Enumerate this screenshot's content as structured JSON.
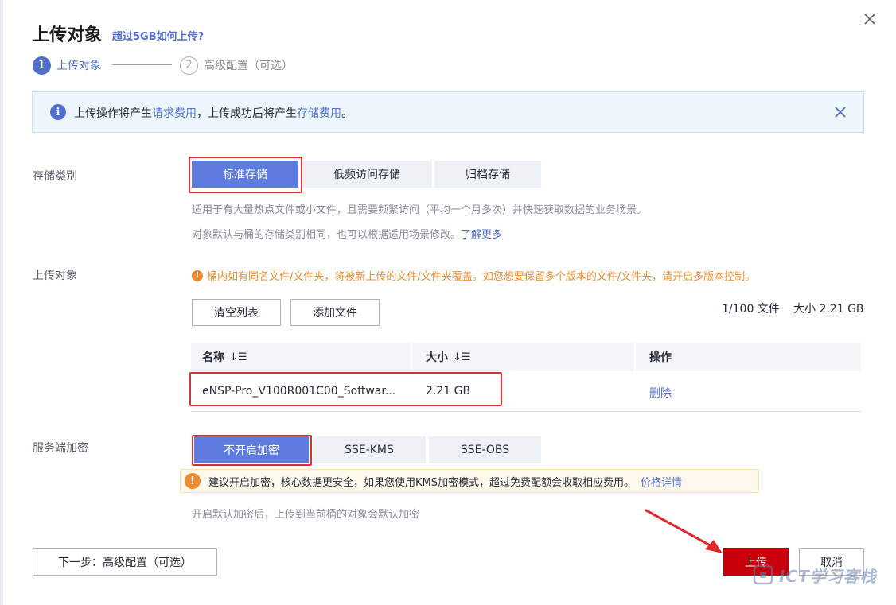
{
  "dialog": {
    "title": "上传对象",
    "title_link": "超过5GB如何上传?",
    "close_icon": "close-icon"
  },
  "steps": [
    {
      "number": "1",
      "label": "上传对象"
    },
    {
      "number": "2",
      "label": "高级配置（可选）"
    }
  ],
  "alert": {
    "text_1": "上传操作将产生",
    "link_1": "请求费用",
    "text_2": "，上传成功后将产生",
    "link_2": "存储费用",
    "text_3": "。"
  },
  "storage": {
    "label": "存储类别",
    "options": [
      "标准存储",
      "低频访问存储",
      "归档存储"
    ],
    "selected": "标准存储",
    "hint_1": "适用于有大量热点文件或小文件，且需要频繁访问（平均一个月多次）并快速获取数据的业务场景。",
    "hint_2": "对象默认与桶的存储类别相同，也可以根据适用场景修改。",
    "hint_link": "了解更多"
  },
  "upload": {
    "label": "上传对象",
    "warning": "桶内如有同名文件/文件夹，将被新上传的文件/文件夹覆盖。如您想要保留多个版本的文件/文件夹，请开启多版本控制。",
    "clear_button": "清空列表",
    "add_button": "添加文件",
    "file_count": "1/100 文件",
    "total_size": "大小 2.21 GB",
    "columns": [
      "名称",
      "大小",
      "操作"
    ],
    "sort_icon": "sort-icon",
    "rows": [
      {
        "name": "eNSP-Pro_V100R001C00_Softwar...",
        "size": "2.21 GB",
        "action": "删除"
      }
    ]
  },
  "encryption": {
    "label": "服务端加密",
    "options": [
      "不开启加密",
      "SSE-KMS",
      "SSE-OBS"
    ],
    "selected": "不开启加密",
    "tip": "建议开启加密，核心数据更安全，如果您使用KMS加密模式，超过免费配额会收取相应费用。",
    "tip_link": "价格详情",
    "hint": "开启默认加密后，上传到当前桶的对象会默认加密"
  },
  "footer": {
    "next_button": "下一步：高级配置（可选）",
    "upload_button": "上传",
    "cancel_button": "取消"
  },
  "watermark": {
    "text": "ICT学习客栈"
  },
  "colors": {
    "accent": "#526ecc",
    "segment_active": "#5e7ce0",
    "primary_button": "#c7000b",
    "warning": "#ef8b2e",
    "annotation_red": "#d63434"
  }
}
